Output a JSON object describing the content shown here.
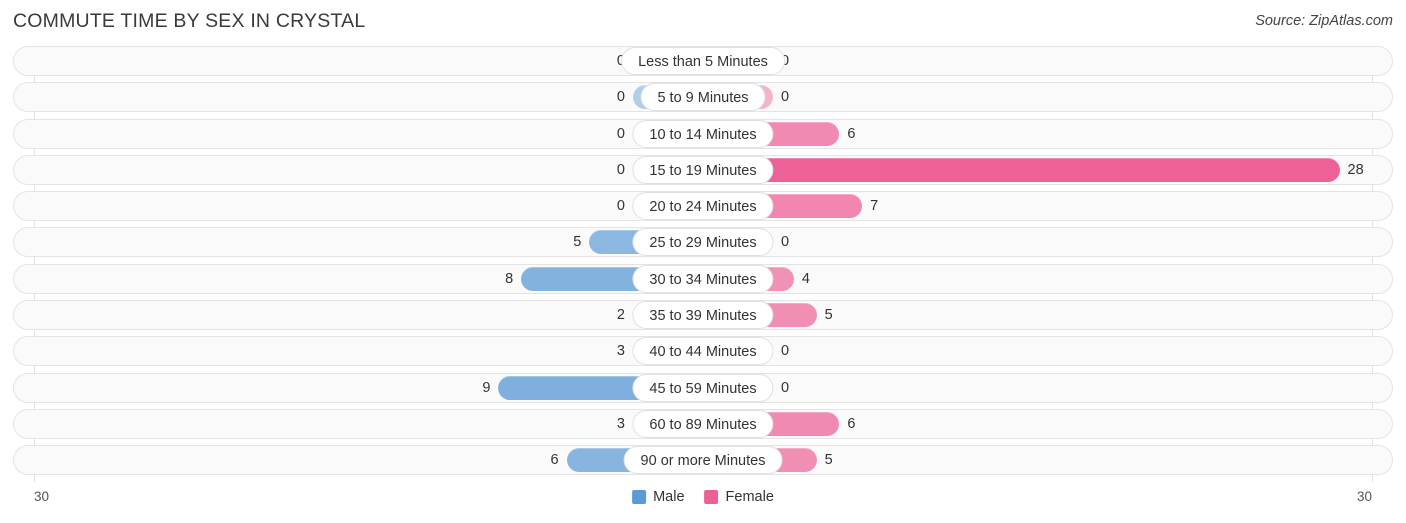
{
  "header": {
    "title": "COMMUTE TIME BY SEX IN CRYSTAL",
    "source": "Source: ZipAtlas.com"
  },
  "legend": {
    "male_label": "Male",
    "female_label": "Female",
    "male_color": "#5b9bd5",
    "female_color": "#ee5f96"
  },
  "axis": {
    "left_label": "30",
    "right_label": "30",
    "max": 30
  },
  "chart_data": {
    "type": "bar",
    "orientation": "horizontal-diverging",
    "title": "COMMUTE TIME BY SEX IN CRYSTAL",
    "xlabel": "",
    "ylabel": "",
    "xlim": [
      30,
      30
    ],
    "grid": true,
    "legend_position": "bottom-center",
    "categories": [
      "Less than 5 Minutes",
      "5 to 9 Minutes",
      "10 to 14 Minutes",
      "15 to 19 Minutes",
      "20 to 24 Minutes",
      "25 to 29 Minutes",
      "30 to 34 Minutes",
      "35 to 39 Minutes",
      "40 to 44 Minutes",
      "45 to 59 Minutes",
      "60 to 89 Minutes",
      "90 or more Minutes"
    ],
    "series": [
      {
        "name": "Male",
        "color": "#5b9bd5",
        "values": [
          0,
          0,
          0,
          0,
          0,
          5,
          8,
          2,
          3,
          9,
          3,
          6
        ]
      },
      {
        "name": "Female",
        "color": "#ee5f96",
        "values": [
          0,
          0,
          6,
          28,
          7,
          0,
          4,
          5,
          0,
          0,
          6,
          5
        ]
      }
    ]
  },
  "rows": [
    {
      "label": "Less than 5 Minutes",
      "male": "0",
      "female": "0"
    },
    {
      "label": "5 to 9 Minutes",
      "male": "0",
      "female": "0"
    },
    {
      "label": "10 to 14 Minutes",
      "male": "0",
      "female": "6"
    },
    {
      "label": "15 to 19 Minutes",
      "male": "0",
      "female": "28"
    },
    {
      "label": "20 to 24 Minutes",
      "male": "0",
      "female": "7"
    },
    {
      "label": "25 to 29 Minutes",
      "male": "5",
      "female": "0"
    },
    {
      "label": "30 to 34 Minutes",
      "male": "8",
      "female": "4"
    },
    {
      "label": "35 to 39 Minutes",
      "male": "2",
      "female": "5"
    },
    {
      "label": "40 to 44 Minutes",
      "male": "3",
      "female": "0"
    },
    {
      "label": "45 to 59 Minutes",
      "male": "9",
      "female": "0"
    },
    {
      "label": "60 to 89 Minutes",
      "male": "3",
      "female": "6"
    },
    {
      "label": "90 or more Minutes",
      "male": "6",
      "female": "5"
    }
  ]
}
